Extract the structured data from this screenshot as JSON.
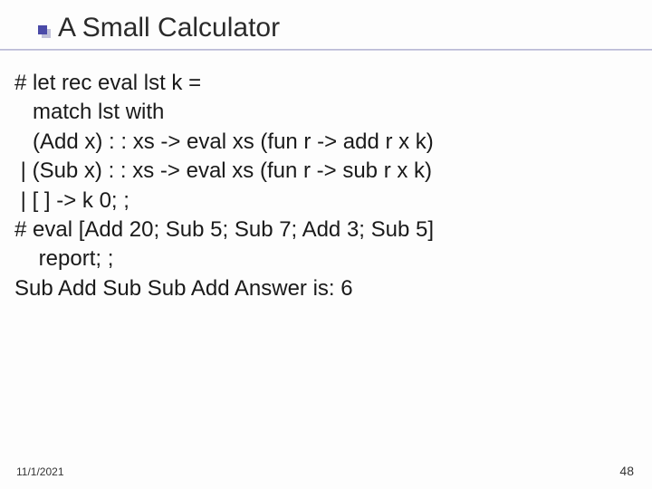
{
  "title": "A Small Calculator",
  "code": {
    "l1": "# let rec eval lst k =",
    "l2": "   match lst with",
    "l3": "   (Add x) : : xs -> eval xs (fun r -> add r x k)",
    "l4": " | (Sub x) : : xs -> eval xs (fun r -> sub r x k)",
    "l5": " | [ ] -> k 0; ;",
    "l6": "# eval [Add 20; Sub 5; Sub 7; Add 3; Sub 5]",
    "l7": "    report; ;",
    "l8": "Sub Add Sub Sub Add Answer is: 6"
  },
  "footer": {
    "date": "11/1/2021",
    "page": "48"
  }
}
